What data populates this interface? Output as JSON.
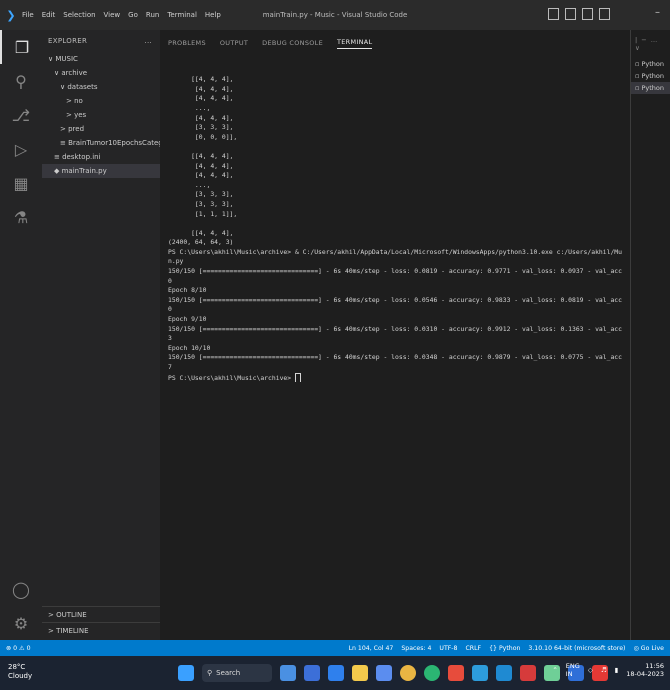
{
  "app": {
    "window_title": "mainTrain.py - Music - Visual Studio Code",
    "menu": [
      "File",
      "Edit",
      "Selection",
      "View",
      "Go",
      "Run",
      "Terminal",
      "Help"
    ]
  },
  "sidebar": {
    "header": "EXPLORER",
    "more": "...",
    "tree": [
      {
        "label": "∨ MUSIC",
        "indent": 0
      },
      {
        "label": "∨ archive",
        "indent": 1
      },
      {
        "label": "∨ datasets",
        "indent": 2
      },
      {
        "label": "> no",
        "indent": 3
      },
      {
        "label": "> yes",
        "indent": 3
      },
      {
        "label": "> pred",
        "indent": 2
      },
      {
        "label": "≡ BrainTumor10EpochsCategorical.h5",
        "indent": 2
      },
      {
        "label": "≡ desktop.ini",
        "indent": 1
      },
      {
        "label": "◆ mainTrain.py",
        "indent": 1,
        "selected": true
      }
    ],
    "outline": "> OUTLINE",
    "timeline": "> TIMELINE"
  },
  "panel": {
    "tabs": [
      "PROBLEMS",
      "OUTPUT",
      "DEBUG CONSOLE",
      "TERMINAL"
    ],
    "active_tab": "TERMINAL",
    "terminal_lines": [
      "",
      "",
      "      [[4, 4, 4],",
      "       [4, 4, 4],",
      "       [4, 4, 4],",
      "       ...,",
      "       [4, 4, 4],",
      "       [3, 3, 3],",
      "       [0, 0, 0]],",
      "",
      "      [[4, 4, 4],",
      "       [4, 4, 4],",
      "       [4, 4, 4],",
      "       ...,",
      "       [3, 3, 3],",
      "       [3, 3, 3],",
      "       [1, 1, 1]],",
      "",
      "      [[4, 4, 4],",
      "(2400, 64, 64, 3)",
      "PS C:\\Users\\akhil\\Music\\archive> & C:/Users/akhil/AppData/Local/Microsoft/WindowsApps/python3.10.exe c:/Users/akhil/Music/mainTrai",
      "n.py",
      "150/150 [==============================] - 6s 40ms/step - loss: 0.0819 - accuracy: 0.9771 - val_loss: 0.0937 - val_accuracy: 0.965",
      "0",
      "Epoch 8/10",
      "150/150 [==============================] - 6s 40ms/step - loss: 0.0546 - accuracy: 0.9833 - val_loss: 0.0819 - val_accuracy: 0.975",
      "0",
      "Epoch 9/10",
      "150/150 [==============================] - 6s 40ms/step - loss: 0.0310 - accuracy: 0.9912 - val_loss: 0.1363 - val_accuracy: 0.953",
      "3",
      "Epoch 10/10",
      "150/150 [==============================] - 6s 40ms/step - loss: 0.0348 - accuracy: 0.9879 - val_loss: 0.0775 - val_accuracy: 0.976",
      "7",
      "PS C:\\Users\\akhil\\Music\\archive> "
    ],
    "sessions": [
      "Python",
      "Python",
      "Python"
    ],
    "session_controls": "| − … ∨"
  },
  "statusbar": {
    "left": "⊗ 0 ⚠ 0",
    "position": "Ln 104, Col 47",
    "spaces": "Spaces: 4",
    "encoding": "UTF-8",
    "eol": "CRLF",
    "language": "{} Python",
    "interpreter": "3.10.10 64-bit (microsoft store)",
    "golive": "◎ Go Live"
  },
  "taskbar": {
    "temp": "28°C",
    "weather": "Cloudy",
    "search_placeholder": "Search",
    "lang": "ENG",
    "region": "IN",
    "time": "11:56",
    "date": "18-04-2023"
  }
}
